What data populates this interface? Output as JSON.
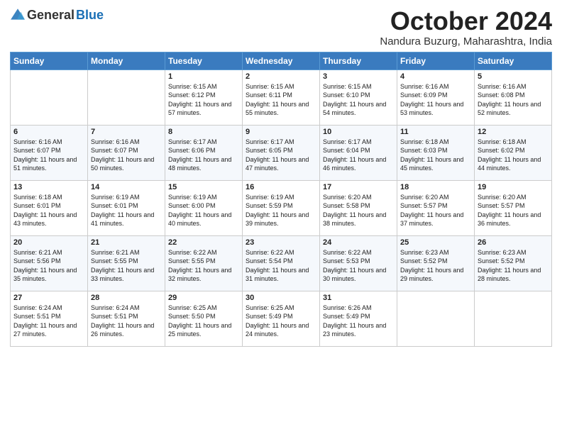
{
  "logo": {
    "general": "General",
    "blue": "Blue"
  },
  "header": {
    "month": "October 2024",
    "location": "Nandura Buzurg, Maharashtra, India"
  },
  "weekdays": [
    "Sunday",
    "Monday",
    "Tuesday",
    "Wednesday",
    "Thursday",
    "Friday",
    "Saturday"
  ],
  "weeks": [
    [
      {
        "day": "",
        "sunrise": "",
        "sunset": "",
        "daylight": ""
      },
      {
        "day": "",
        "sunrise": "",
        "sunset": "",
        "daylight": ""
      },
      {
        "day": "1",
        "sunrise": "Sunrise: 6:15 AM",
        "sunset": "Sunset: 6:12 PM",
        "daylight": "Daylight: 11 hours and 57 minutes."
      },
      {
        "day": "2",
        "sunrise": "Sunrise: 6:15 AM",
        "sunset": "Sunset: 6:11 PM",
        "daylight": "Daylight: 11 hours and 55 minutes."
      },
      {
        "day": "3",
        "sunrise": "Sunrise: 6:15 AM",
        "sunset": "Sunset: 6:10 PM",
        "daylight": "Daylight: 11 hours and 54 minutes."
      },
      {
        "day": "4",
        "sunrise": "Sunrise: 6:16 AM",
        "sunset": "Sunset: 6:09 PM",
        "daylight": "Daylight: 11 hours and 53 minutes."
      },
      {
        "day": "5",
        "sunrise": "Sunrise: 6:16 AM",
        "sunset": "Sunset: 6:08 PM",
        "daylight": "Daylight: 11 hours and 52 minutes."
      }
    ],
    [
      {
        "day": "6",
        "sunrise": "Sunrise: 6:16 AM",
        "sunset": "Sunset: 6:07 PM",
        "daylight": "Daylight: 11 hours and 51 minutes."
      },
      {
        "day": "7",
        "sunrise": "Sunrise: 6:16 AM",
        "sunset": "Sunset: 6:07 PM",
        "daylight": "Daylight: 11 hours and 50 minutes."
      },
      {
        "day": "8",
        "sunrise": "Sunrise: 6:17 AM",
        "sunset": "Sunset: 6:06 PM",
        "daylight": "Daylight: 11 hours and 48 minutes."
      },
      {
        "day": "9",
        "sunrise": "Sunrise: 6:17 AM",
        "sunset": "Sunset: 6:05 PM",
        "daylight": "Daylight: 11 hours and 47 minutes."
      },
      {
        "day": "10",
        "sunrise": "Sunrise: 6:17 AM",
        "sunset": "Sunset: 6:04 PM",
        "daylight": "Daylight: 11 hours and 46 minutes."
      },
      {
        "day": "11",
        "sunrise": "Sunrise: 6:18 AM",
        "sunset": "Sunset: 6:03 PM",
        "daylight": "Daylight: 11 hours and 45 minutes."
      },
      {
        "day": "12",
        "sunrise": "Sunrise: 6:18 AM",
        "sunset": "Sunset: 6:02 PM",
        "daylight": "Daylight: 11 hours and 44 minutes."
      }
    ],
    [
      {
        "day": "13",
        "sunrise": "Sunrise: 6:18 AM",
        "sunset": "Sunset: 6:01 PM",
        "daylight": "Daylight: 11 hours and 43 minutes."
      },
      {
        "day": "14",
        "sunrise": "Sunrise: 6:19 AM",
        "sunset": "Sunset: 6:01 PM",
        "daylight": "Daylight: 11 hours and 41 minutes."
      },
      {
        "day": "15",
        "sunrise": "Sunrise: 6:19 AM",
        "sunset": "Sunset: 6:00 PM",
        "daylight": "Daylight: 11 hours and 40 minutes."
      },
      {
        "day": "16",
        "sunrise": "Sunrise: 6:19 AM",
        "sunset": "Sunset: 5:59 PM",
        "daylight": "Daylight: 11 hours and 39 minutes."
      },
      {
        "day": "17",
        "sunrise": "Sunrise: 6:20 AM",
        "sunset": "Sunset: 5:58 PM",
        "daylight": "Daylight: 11 hours and 38 minutes."
      },
      {
        "day": "18",
        "sunrise": "Sunrise: 6:20 AM",
        "sunset": "Sunset: 5:57 PM",
        "daylight": "Daylight: 11 hours and 37 minutes."
      },
      {
        "day": "19",
        "sunrise": "Sunrise: 6:20 AM",
        "sunset": "Sunset: 5:57 PM",
        "daylight": "Daylight: 11 hours and 36 minutes."
      }
    ],
    [
      {
        "day": "20",
        "sunrise": "Sunrise: 6:21 AM",
        "sunset": "Sunset: 5:56 PM",
        "daylight": "Daylight: 11 hours and 35 minutes."
      },
      {
        "day": "21",
        "sunrise": "Sunrise: 6:21 AM",
        "sunset": "Sunset: 5:55 PM",
        "daylight": "Daylight: 11 hours and 33 minutes."
      },
      {
        "day": "22",
        "sunrise": "Sunrise: 6:22 AM",
        "sunset": "Sunset: 5:55 PM",
        "daylight": "Daylight: 11 hours and 32 minutes."
      },
      {
        "day": "23",
        "sunrise": "Sunrise: 6:22 AM",
        "sunset": "Sunset: 5:54 PM",
        "daylight": "Daylight: 11 hours and 31 minutes."
      },
      {
        "day": "24",
        "sunrise": "Sunrise: 6:22 AM",
        "sunset": "Sunset: 5:53 PM",
        "daylight": "Daylight: 11 hours and 30 minutes."
      },
      {
        "day": "25",
        "sunrise": "Sunrise: 6:23 AM",
        "sunset": "Sunset: 5:52 PM",
        "daylight": "Daylight: 11 hours and 29 minutes."
      },
      {
        "day": "26",
        "sunrise": "Sunrise: 6:23 AM",
        "sunset": "Sunset: 5:52 PM",
        "daylight": "Daylight: 11 hours and 28 minutes."
      }
    ],
    [
      {
        "day": "27",
        "sunrise": "Sunrise: 6:24 AM",
        "sunset": "Sunset: 5:51 PM",
        "daylight": "Daylight: 11 hours and 27 minutes."
      },
      {
        "day": "28",
        "sunrise": "Sunrise: 6:24 AM",
        "sunset": "Sunset: 5:51 PM",
        "daylight": "Daylight: 11 hours and 26 minutes."
      },
      {
        "day": "29",
        "sunrise": "Sunrise: 6:25 AM",
        "sunset": "Sunset: 5:50 PM",
        "daylight": "Daylight: 11 hours and 25 minutes."
      },
      {
        "day": "30",
        "sunrise": "Sunrise: 6:25 AM",
        "sunset": "Sunset: 5:49 PM",
        "daylight": "Daylight: 11 hours and 24 minutes."
      },
      {
        "day": "31",
        "sunrise": "Sunrise: 6:26 AM",
        "sunset": "Sunset: 5:49 PM",
        "daylight": "Daylight: 11 hours and 23 minutes."
      },
      {
        "day": "",
        "sunrise": "",
        "sunset": "",
        "daylight": ""
      },
      {
        "day": "",
        "sunrise": "",
        "sunset": "",
        "daylight": ""
      }
    ]
  ]
}
